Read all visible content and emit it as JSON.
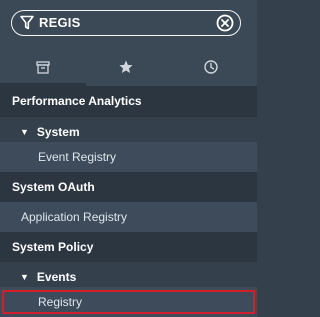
{
  "filter": {
    "value": "REGIS",
    "icons": {
      "filter": "filter-funnel-icon",
      "clear": "clear-circle-x-icon"
    }
  },
  "tabs": [
    {
      "icon": "archive-box-icon"
    },
    {
      "icon": "star-icon"
    },
    {
      "icon": "clock-history-icon"
    }
  ],
  "menu": {
    "app1": "Performance Analytics",
    "app1_section": "System",
    "app1_module": "Event Registry",
    "app2": "System OAuth",
    "app2_module": "Application Registry",
    "app3": "System Policy",
    "app3_section": "Events",
    "app3_module": "Registry"
  },
  "colors": {
    "background": "#34404c",
    "header": "#2c3641",
    "selected_outline": "#d21f2b"
  }
}
